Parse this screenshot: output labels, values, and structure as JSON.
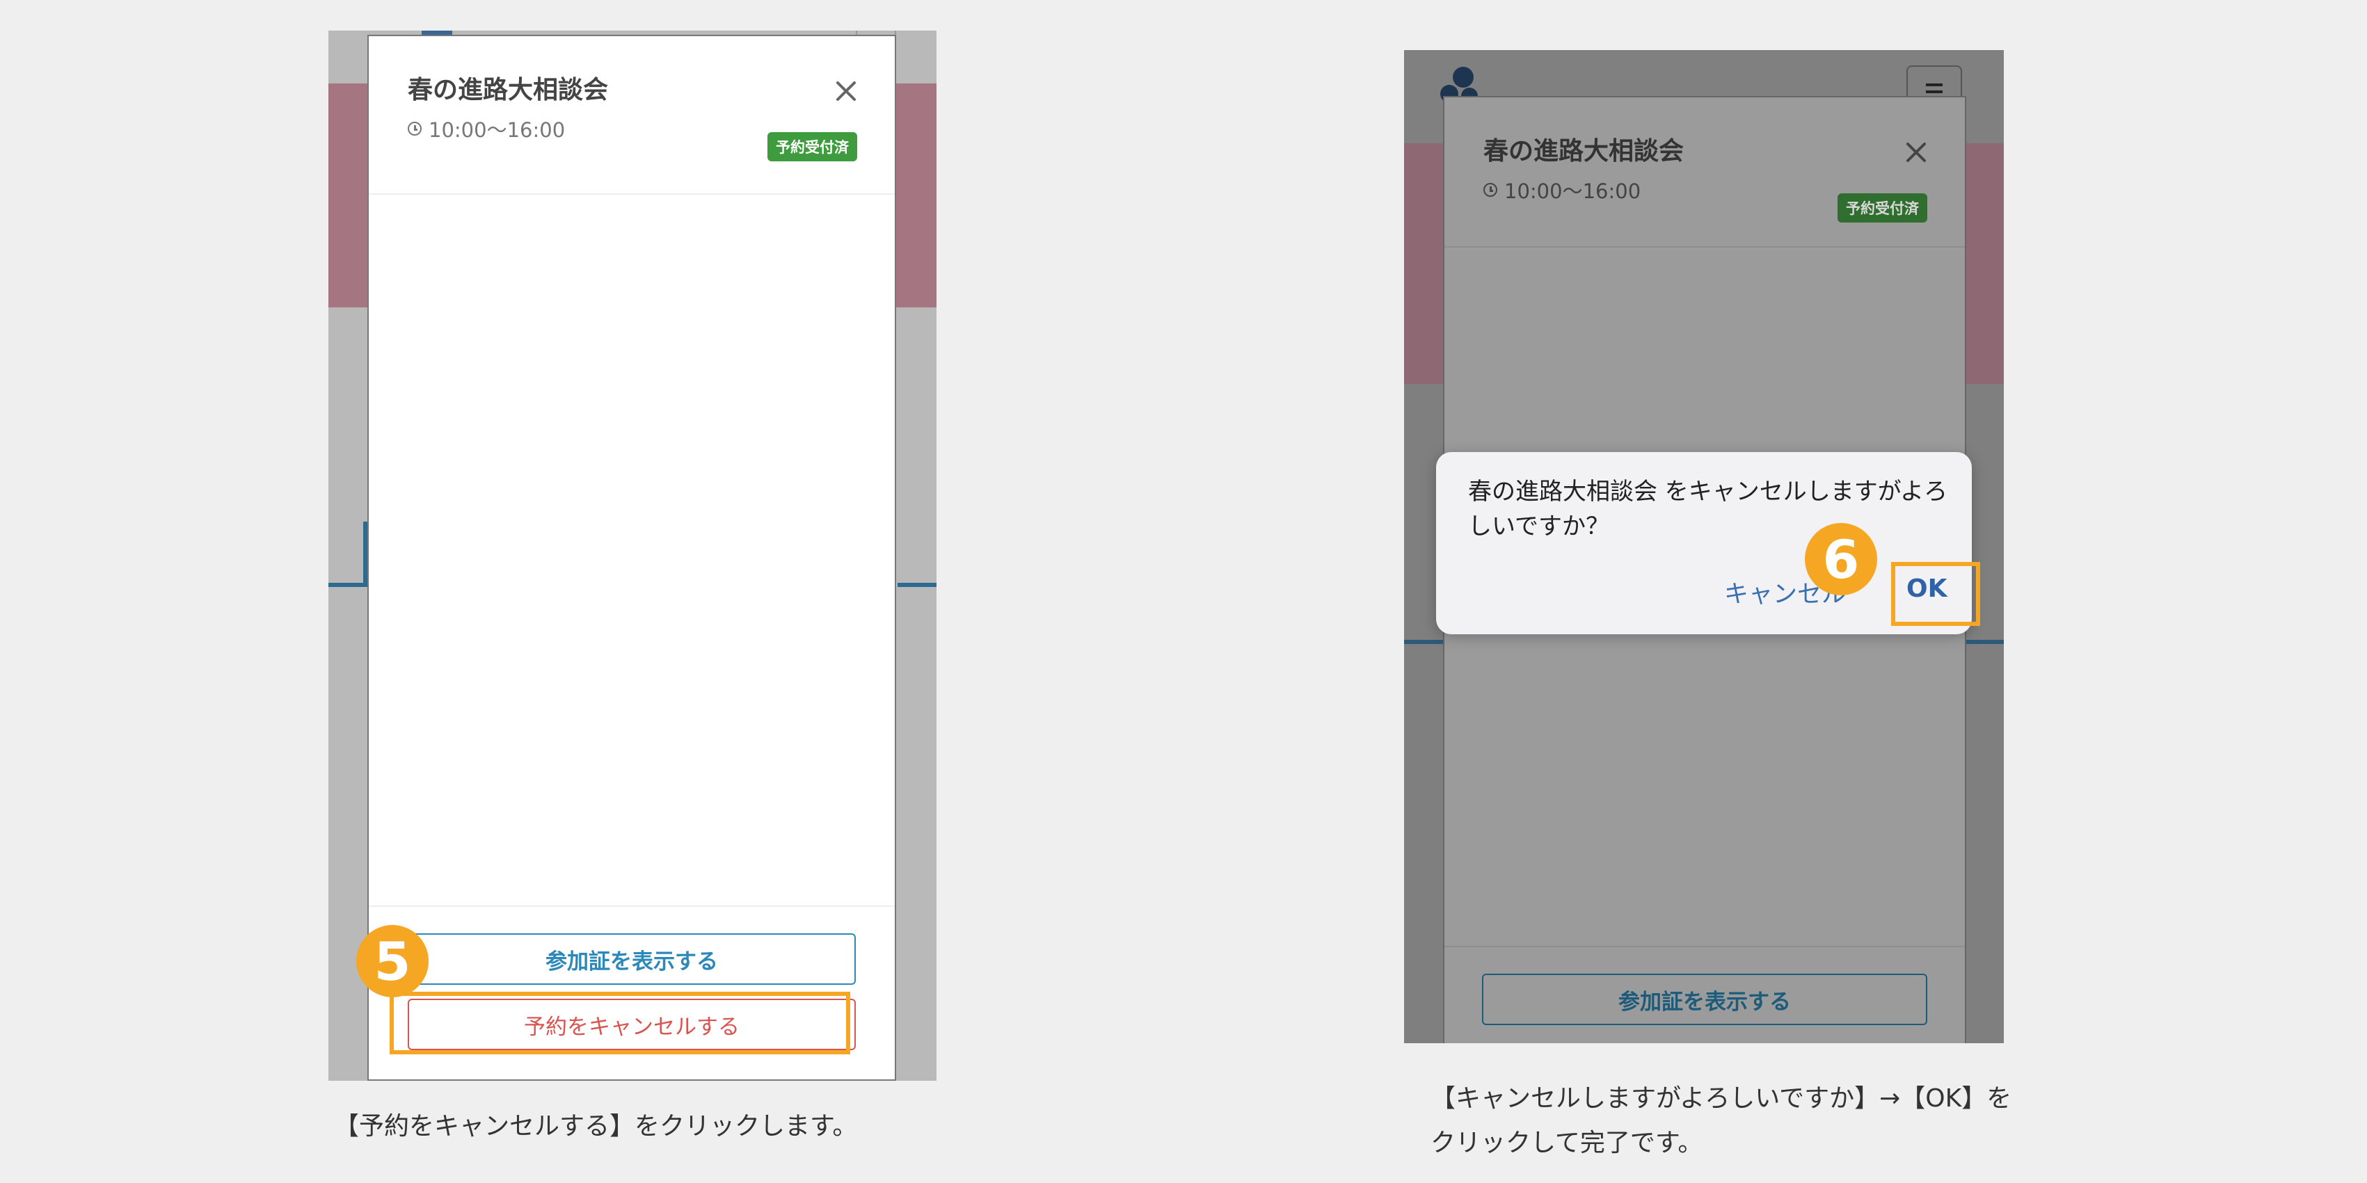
{
  "colors": {
    "background": "#efefef",
    "highlight": "#f5a623",
    "primary": "#2b88b8",
    "danger": "#d9534f",
    "badge_green": "#3e9b3e"
  },
  "screen_left": {
    "modal": {
      "title": "春の進路大相談会",
      "time": "10:00〜16:00",
      "status_badge": "予約受付済",
      "close_icon": "close-icon",
      "show_pass_button": "参加証を表示する",
      "cancel_reservation_button": "予約をキャンセルする"
    },
    "step": "5",
    "caption": "【予約をキャンセルする】をクリックします。"
  },
  "screen_right": {
    "modal": {
      "title": "春の進路大相談会",
      "time": "10:00〜16:00",
      "status_badge": "予約受付済",
      "show_pass_button": "参加証を表示する"
    },
    "dialog": {
      "message": "春の進路大相談会 をキャンセルしますがよろしいですか？",
      "cancel": "キャンセル",
      "ok": "OK"
    },
    "step": "6",
    "caption": "【キャンセルしますがよろしいですか】→【OK】をクリックして完了です。"
  }
}
